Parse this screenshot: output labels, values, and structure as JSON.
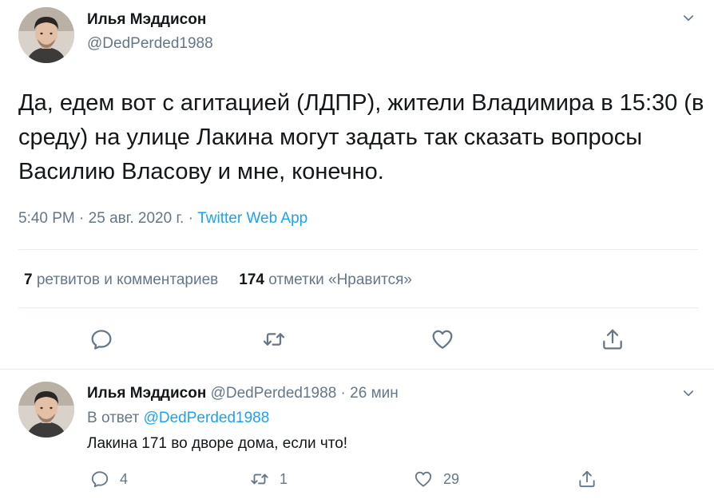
{
  "main_tweet": {
    "author_name": "Илья Мэддисон",
    "author_handle": "@DedPerded1988",
    "text": "Да, едем вот с агитацией (ЛДПР), жители Владимира в 15:30 (в среду) на улице Лакина могут задать так сказать вопросы Василию Власову и мне, конечно.",
    "time": "5:40 PM",
    "date": "25 авг. 2020 г.",
    "source": "Twitter Web App",
    "separator": "·",
    "retweets_count": "7",
    "retweets_label": "ретвитов и комментариев",
    "likes_count": "174",
    "likes_label": "отметки «Нравится»"
  },
  "reply_tweet": {
    "author_name": "Илья Мэддисон",
    "author_handle": "@DedPerded1988",
    "separator": "·",
    "time_ago": "26 мин",
    "reply_prefix": "В ответ",
    "reply_to": "@DedPerded1988",
    "text": "Лакина 171 во дворе дома, если что!",
    "reply_count": "4",
    "retweet_count": "1",
    "like_count": "29"
  },
  "icons": {
    "reply": "reply-icon",
    "retweet": "retweet-icon",
    "like": "heart-icon",
    "share": "share-icon",
    "menu": "chevron-down-icon"
  },
  "colors": {
    "text": "#14171a",
    "secondary": "#657786",
    "link": "#1da1f2",
    "divider": "#e6ecf0"
  }
}
